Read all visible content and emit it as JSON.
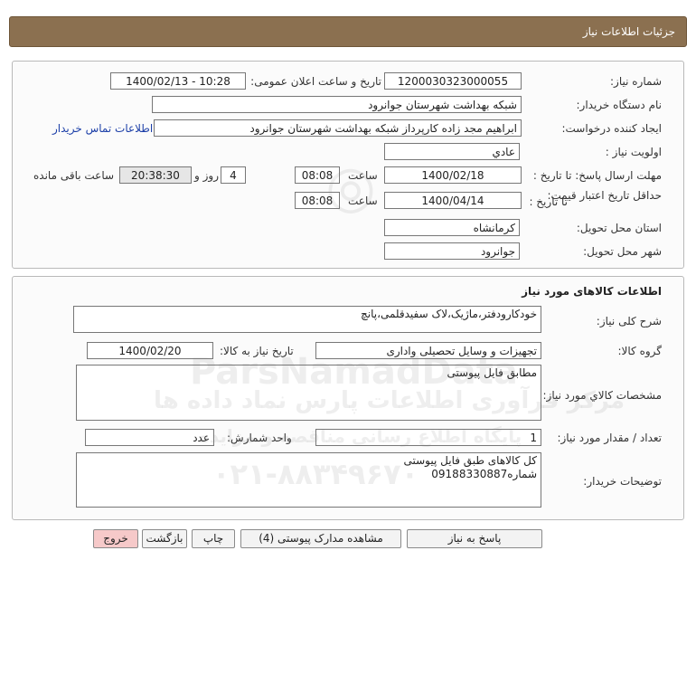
{
  "header": {
    "title": "جزئیات اطلاعات نیاز"
  },
  "need_info": {
    "need_number_label": "شماره نیاز:",
    "need_number": "1200030323000055",
    "announce_label": "تاریخ و ساعت اعلان عمومی:",
    "announce_value": "1400/02/13 - 10:28",
    "buyer_org_label": "نام دستگاه خریدار:",
    "buyer_org": "شبکه بهداشت شهرستان جوانرود",
    "creator_label": "ایجاد کننده درخواست:",
    "creator": "ابراهیم مجد زاده کارپرداز شبکه بهداشت شهرستان جوانرود",
    "contact_link": "اطلاعات تماس خریدار",
    "priority_label": "اولویت نیاز :",
    "priority": "عادي",
    "deadline_label": "مهلت ارسال پاسخ: تا تاریخ :",
    "deadline_date": "1400/02/18",
    "time_label": "ساعت",
    "deadline_time": "08:08",
    "days_value": "4",
    "days_label": "روز و",
    "remaining_time": "20:38:30",
    "remaining_label": "ساعت باقی مانده",
    "validity_label": "حداقل تاریخ اعتبار قیمت:",
    "validity_until_label": "تا تاریخ :",
    "validity_date": "1400/04/14",
    "validity_time": "08:08",
    "province_label": "استان محل تحویل:",
    "province": "کرمانشاه",
    "city_label": "شهر محل تحویل:",
    "city": "جوانرود"
  },
  "goods": {
    "section_title": "اطلاعات کالاهای مورد نیاز",
    "description_label": "شرح کلی نیاز:",
    "description": "خودکارودفتر،ماژیک،لاک سفیدقلمی،پانچ",
    "group_label": "گروه کالا:",
    "group": "تجهیزات و وسایل تحصیلی واداری",
    "need_date_label": "تاریخ نیاز به کالا:",
    "need_date": "1400/02/20",
    "spec_label": "مشخصات کالاي مورد نیاز:",
    "spec": "مطابق فایل پیوستی",
    "qty_label": "تعداد / مقدار مورد نیاز:",
    "qty": "1",
    "unit_label": "واحد شمارش:",
    "unit": "عدد",
    "buyer_notes_label": "توضیحات خریدار:",
    "buyer_notes_line1": "کل کالاهای طبق فایل پیوستی",
    "buyer_notes_line2": "شماره09188330887"
  },
  "buttons": {
    "reply": "پاسخ به نیاز",
    "attachments": "مشاهده مدارک پیوستی (4)",
    "print": "چاپ",
    "back": "بازگشت",
    "exit": "خروج"
  },
  "watermark": {
    "brand": "ParsNamadData",
    "line1": "مرکز فرآوری اطلاعات پارس نماد داده ها",
    "line2": "پایگاه اطلاع رسانی مناقصه و مزایده",
    "phone": "۰۲۱-۸۸۳۴۹۶۷۰"
  },
  "colors": {
    "header_bg": "#8b7050",
    "link": "#1c3fa8",
    "exit_bg": "#f6c9c9"
  }
}
